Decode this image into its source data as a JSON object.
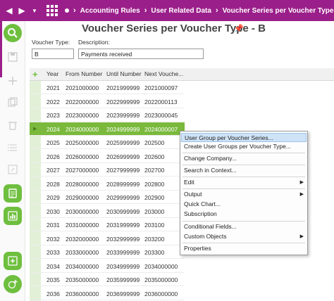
{
  "nav": {
    "crumbs": [
      "Accounting Rules",
      "User Related Data",
      "Voucher Series per Voucher Type"
    ]
  },
  "page": {
    "title": "Voucher Series per Voucher Type - B",
    "voucher_type_label": "Voucher Type:",
    "voucher_type_value": "B",
    "description_label": "Description:",
    "description_value": "Payments received"
  },
  "grid": {
    "columns": [
      "Year",
      "From Number",
      "Until Number",
      "Next Vouche..."
    ],
    "rows": [
      [
        "2021",
        "2021000000",
        "2021999999",
        "2021000097"
      ],
      [
        "2022",
        "2022000000",
        "2022999999",
        "2022000113"
      ],
      [
        "2023",
        "2023000000",
        "2023999999",
        "2023000045"
      ],
      [
        "2024",
        "2024000000",
        "2024999999",
        "2024000007"
      ],
      [
        "2025",
        "2025000000",
        "2025999999",
        "202500"
      ],
      [
        "2026",
        "2026000000",
        "2026999999",
        "202600"
      ],
      [
        "2027",
        "2027000000",
        "2027999999",
        "202700"
      ],
      [
        "2028",
        "2028000000",
        "2028999999",
        "202800"
      ],
      [
        "2029",
        "2029000000",
        "2029999999",
        "202900"
      ],
      [
        "2030",
        "2030000000",
        "2030999999",
        "203000"
      ],
      [
        "2031",
        "2031000000",
        "2031999999",
        "203100"
      ],
      [
        "2032",
        "2032000000",
        "2032999999",
        "203200"
      ],
      [
        "2033",
        "2033000000",
        "2033999999",
        "203300"
      ],
      [
        "2034",
        "2034000000",
        "2034999999",
        "2034000000"
      ],
      [
        "2035",
        "2035000000",
        "2035999999",
        "2035000000"
      ],
      [
        "2036",
        "2036000000",
        "2036999999",
        "2036000000"
      ]
    ]
  },
  "context_menu": {
    "items": [
      "User Group per Voucher Series...",
      "Create User Groups per Voucher Type...",
      "Change Company...",
      "Search in Context...",
      "Edit",
      "Output",
      "Quick Chart...",
      "Subscription",
      "Conditional Fields...",
      "Custom Objects",
      "Properties"
    ]
  },
  "colors": {
    "nav_bar": "#9b1f8a",
    "accent_green": "#6fbf3f",
    "selected_row": "#7ab93c",
    "menu_highlight": "#cfe3f7"
  }
}
